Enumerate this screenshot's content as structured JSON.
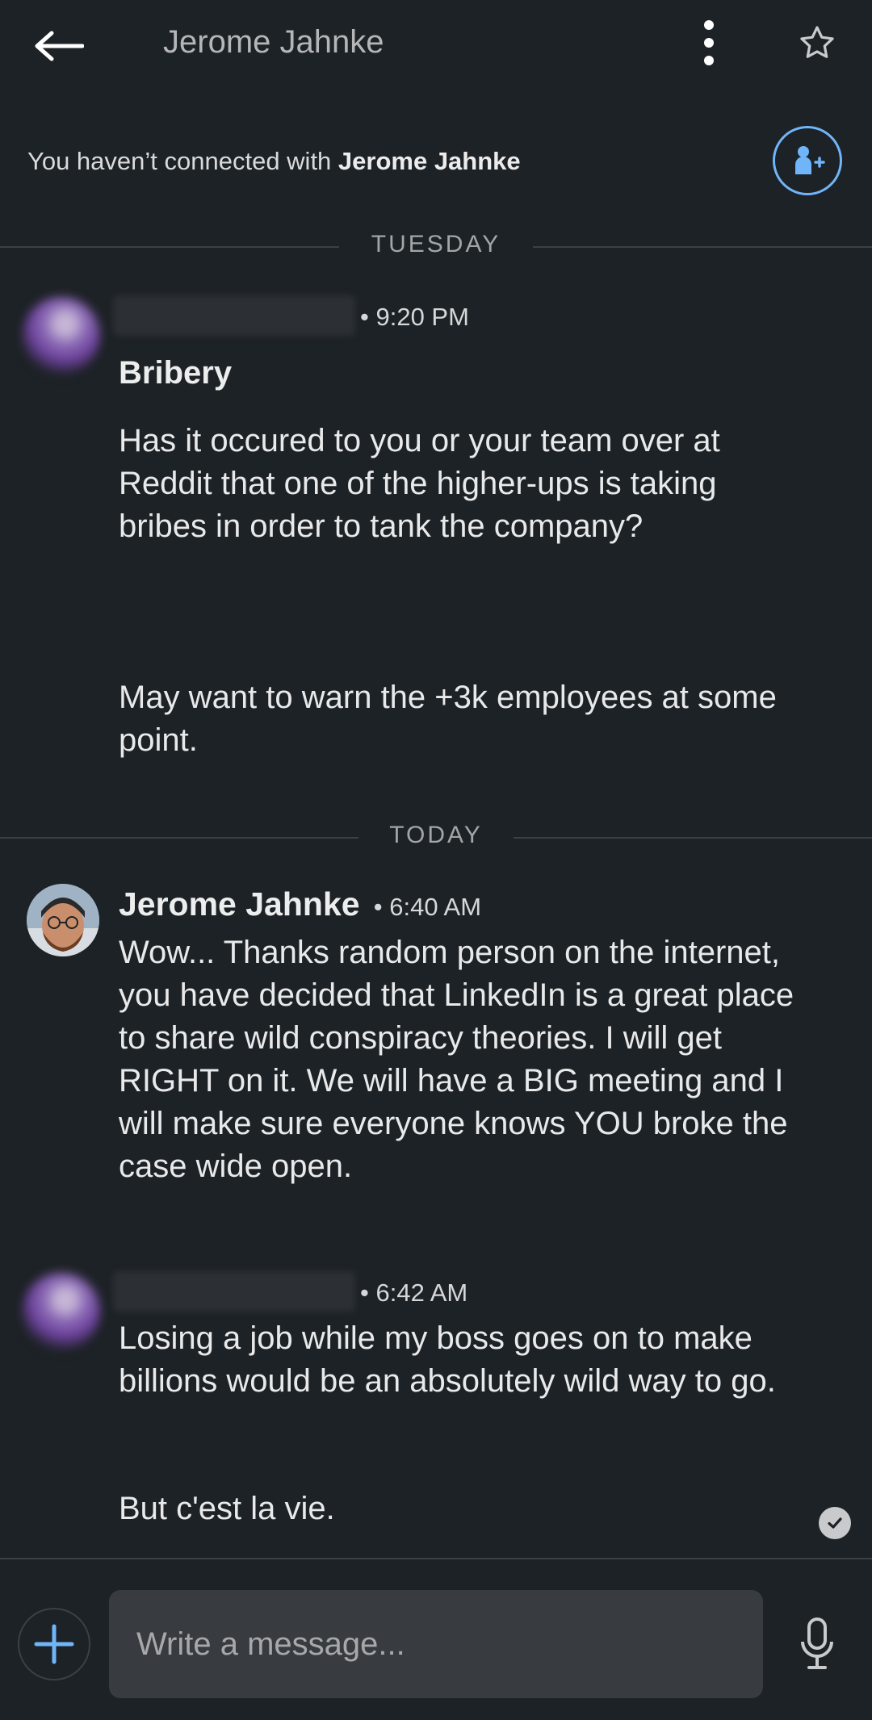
{
  "header": {
    "title": "Jerome Jahnke",
    "back_icon": "arrow-left-icon",
    "more_icon": "more-vertical-icon",
    "star_icon": "star-outline-icon"
  },
  "connect_banner": {
    "prefix": "You haven’t connected with ",
    "name": "Jerome Jahnke",
    "icon": "add-person-icon"
  },
  "dividers": {
    "tuesday": "TUESDAY",
    "today": "TODAY"
  },
  "messages": [
    {
      "time": "9:20 PM",
      "subject": "Bribery",
      "body_p1": "Has it occured to you or your team over at Reddit that one of the higher-ups is taking bribes in order to tank the company?",
      "body_p2": "May want to warn the +3k employees at some point."
    },
    {
      "sender": "Jerome Jahnke",
      "time": "6:40 AM",
      "body": "Wow... Thanks random person on the internet, you have decided that LinkedIn is a great place to share wild conspiracy theories. I will get RIGHT on it. We will have a BIG meeting and I will make sure everyone knows YOU broke the case wide open."
    },
    {
      "time": "6:42 AM",
      "body_p1": "Losing a job while my boss goes on to make billions would be an absolutely wild way to go.",
      "body_p2": "But c'est la vie."
    }
  ],
  "composer": {
    "placeholder": "Write a message...",
    "plus_icon": "plus-icon",
    "mic_icon": "microphone-icon"
  },
  "colors": {
    "background": "#1d2226",
    "accent": "#70b5f9"
  }
}
